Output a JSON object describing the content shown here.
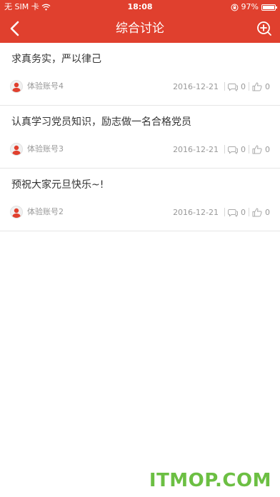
{
  "status_bar": {
    "carrier": "无 SIM 卡",
    "time": "18:08",
    "battery_percent": "97%",
    "battery_level": 0.97
  },
  "navbar": {
    "title": "综合讨论",
    "back_icon": "chevron-left-icon",
    "add_icon": "plus-circle-icon"
  },
  "posts": [
    {
      "title": "求真务实，严以律己",
      "author": "体验账号4",
      "date": "2016-12-21",
      "comments": "0",
      "likes": "0"
    },
    {
      "title": "认真学习党员知识，励志做一名合格党员",
      "author": "体验账号3",
      "date": "2016-12-21",
      "comments": "0",
      "likes": "0"
    },
    {
      "title": "预祝大家元旦快乐~!",
      "author": "体验账号2",
      "date": "2016-12-21",
      "comments": "0",
      "likes": "0"
    }
  ],
  "watermark": "ITMOP.COM",
  "colors": {
    "accent": "#e0402e",
    "watermark": "#6cbf43",
    "muted": "#999999"
  }
}
